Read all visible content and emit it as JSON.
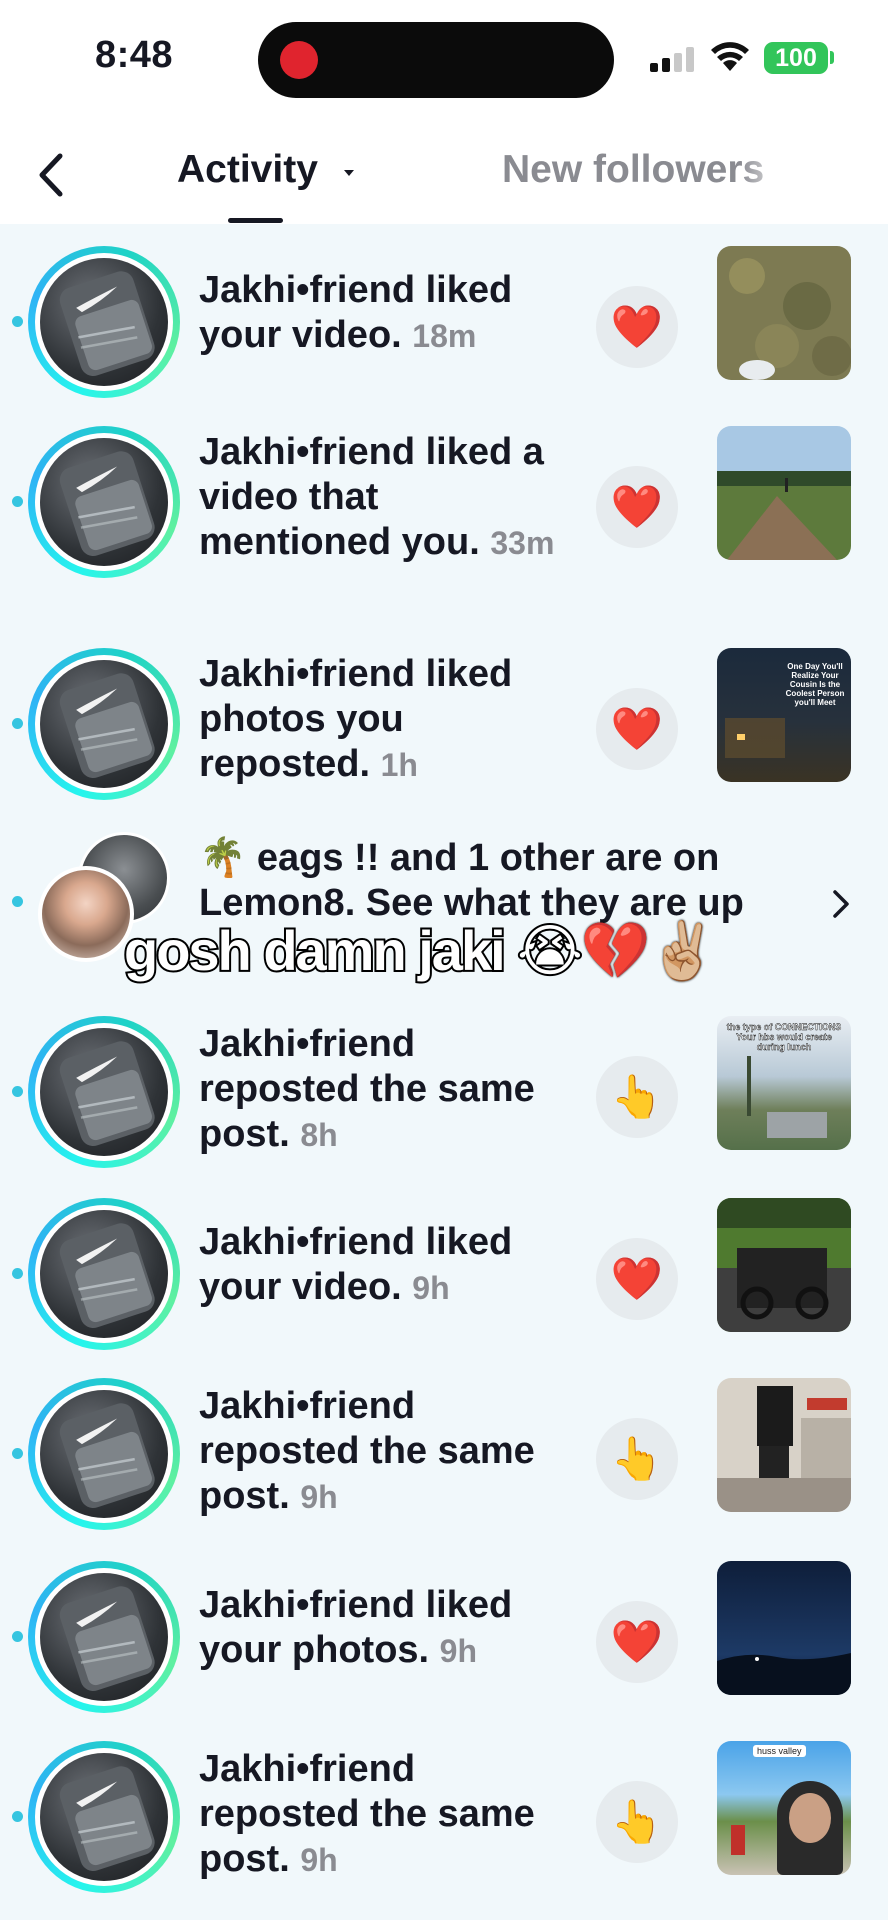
{
  "status_bar": {
    "time": "8:48",
    "battery": "100"
  },
  "header": {
    "tab_active": "Activity",
    "tab_other": "New followers"
  },
  "rows": [
    {
      "name": "Jakhi•friend",
      "text": "liked your video.",
      "ago": "18m",
      "action": "heart",
      "action_glyph": "❤️",
      "thumb": "grass"
    },
    {
      "name": "Jakhi•friend",
      "text": "liked a video that mentioned you.",
      "ago": "33m",
      "action": "heart",
      "action_glyph": "❤️",
      "thumb": "field"
    },
    {
      "name": "Jakhi•friend",
      "text": "liked photos you reposted.",
      "ago": "1h",
      "action": "heart",
      "action_glyph": "❤️",
      "thumb": "night-caption"
    },
    {
      "name": "Jakhi•friend",
      "text": "reposted the same post.",
      "ago": "8h",
      "action": "point",
      "action_glyph": "👆",
      "thumb": "sky-caption"
    },
    {
      "name": "Jakhi•friend",
      "text": "liked your video.",
      "ago": "9h",
      "action": "heart",
      "action_glyph": "❤️",
      "thumb": "bike"
    },
    {
      "name": "Jakhi•friend",
      "text": "reposted the same post.",
      "ago": "9h",
      "action": "point",
      "action_glyph": "👆",
      "thumb": "kitchen"
    },
    {
      "name": "Jakhi•friend",
      "text": "liked your photos.",
      "ago": "9h",
      "action": "heart",
      "action_glyph": "❤️",
      "thumb": "dusk"
    },
    {
      "name": "Jakhi•friend",
      "text": "reposted the same post.",
      "ago": "9h",
      "action": "point",
      "action_glyph": "👆",
      "thumb": "selfie"
    }
  ],
  "lemon8": {
    "text": "🌴 eags !! and 1 other are on Lemon8. See what they are up"
  },
  "thumb_captions": {
    "night": "One Day You'll Realize Your Cousin Is the Coolest Person you'll Meet",
    "sky": "the type of CONNECTIONS Your hbs would create during lunch",
    "selfie": "huss valley"
  },
  "overlay_caption": "gosh damn jaki 😭💔✌🏼"
}
